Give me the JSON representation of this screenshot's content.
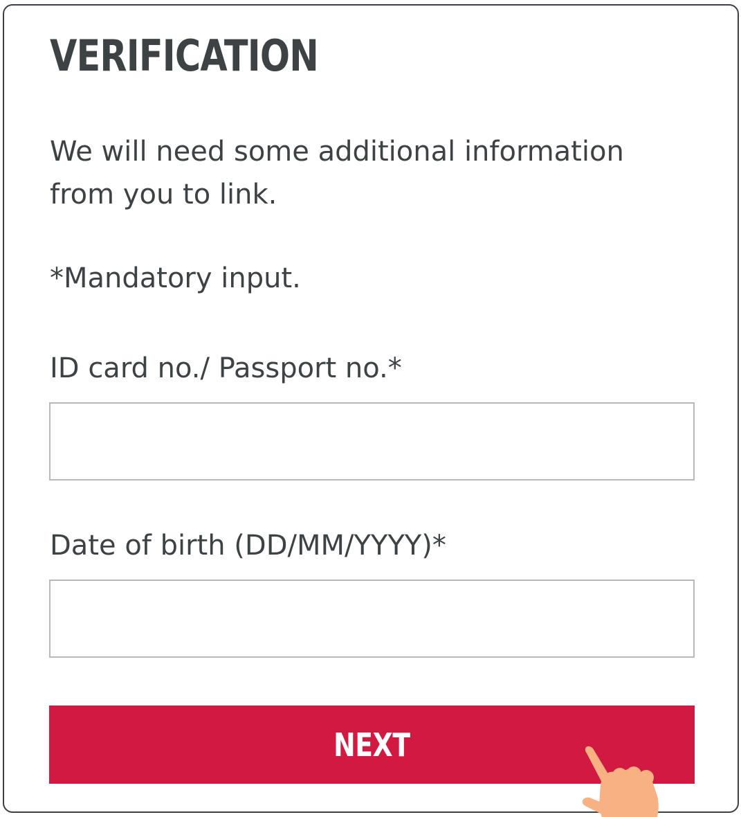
{
  "page": {
    "title": "VERIFICATION",
    "intro": "We will need some additional information from you to link.",
    "mandatory_note": "*Mandatory input."
  },
  "form": {
    "id_label": "ID card no./ Passport no.*",
    "id_value": "",
    "dob_label": "Date of birth (DD/MM/YYYY)*",
    "dob_value": "",
    "next_label": "NEXT"
  },
  "icons": {
    "pointer": "pointing-hand-icon"
  },
  "colors": {
    "accent": "#d21942",
    "text": "#3d4244",
    "border": "#3a4048",
    "input_border": "#b8b8b8",
    "hand": "#f7b183"
  }
}
